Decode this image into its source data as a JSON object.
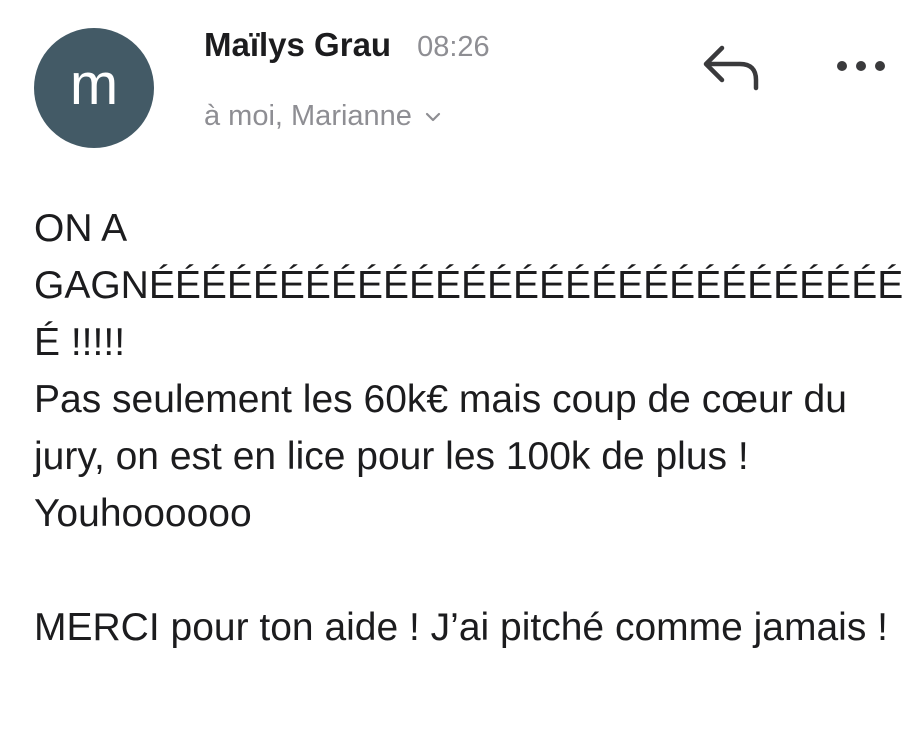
{
  "sender": {
    "avatar_letter": "m",
    "avatar_color": "#435a66",
    "name": "Maïlys Grau",
    "time": "08:26",
    "recipients": "à moi, Marianne"
  },
  "icons": {
    "reply": "reply-arrow-icon",
    "more": "more-horizontal-icon",
    "expand": "chevron-down-icon"
  },
  "message": {
    "line1": "ON A",
    "line2": "GAGNÉÉÉÉÉÉÉÉÉÉÉÉÉÉÉÉÉÉÉÉÉÉÉÉÉÉÉÉÉ",
    "line3": "É !!!!!",
    "paragraph1": "Pas seulement les 60k€ mais coup de cœur du jury, on est en lice pour les 100k de plus ! Youhoooooo",
    "paragraph2": "MERCI pour ton aide ! J’ai pitché comme jamais !"
  }
}
